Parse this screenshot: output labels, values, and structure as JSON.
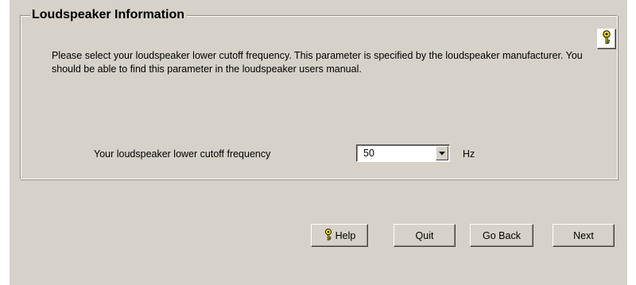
{
  "groupbox": {
    "title": "Loudspeaker Information",
    "description": "Please select your loudspeaker lower cutoff frequency. This parameter is specified by the loudspeaker manufacturer. You should be able to find this parameter in the loudspeaker users manual."
  },
  "frequency": {
    "label": "Your loudspeaker lower cutoff frequency",
    "selected_value": "50",
    "unit": "Hz"
  },
  "buttons": {
    "help_label": "Help",
    "quit_label": "Quit",
    "go_back_label": "Go Back",
    "next_label": "Next"
  },
  "icons": {
    "help_corner": "key-icon",
    "help_button": "key-icon",
    "combo_arrow": "triangle-down-icon"
  },
  "colors": {
    "dialog_background": "#d6d2c9",
    "key_yellow": "#e8d800",
    "text": "#000000"
  }
}
